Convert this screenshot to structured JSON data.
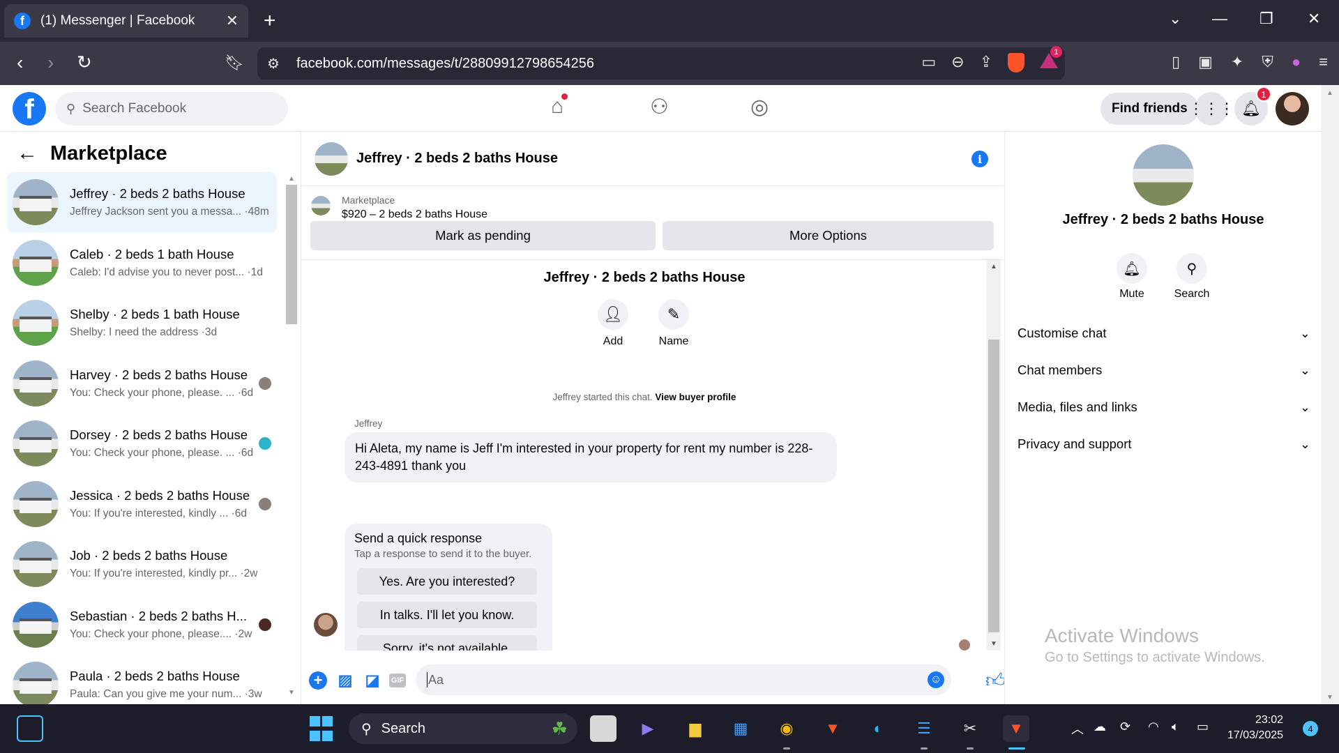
{
  "browser": {
    "tab_title": "(1) Messenger | Facebook",
    "url": "facebook.com/messages/t/28809912798654256",
    "rewards_badge": "1",
    "accent_color": "#fb542b"
  },
  "header": {
    "search_placeholder": "Search Facebook",
    "find_friends_label": "Find friends",
    "notification_count": "1",
    "brand_color": "#1877f2"
  },
  "sidebar": {
    "title": "Marketplace",
    "conversations": [
      {
        "name": "Jeffrey · 2 beds 2 baths House",
        "preview": "Jeffrey Jackson sent you a messa... ·48m",
        "active": true
      },
      {
        "name": "Caleb · 2 beds 1 bath House",
        "preview": "Caleb: I'd advise you to never post... ·1d"
      },
      {
        "name": "Shelby · 2 beds 1 bath House",
        "preview": "Shelby: I need the address ·3d"
      },
      {
        "name": "Harvey · 2 beds 2 baths House",
        "preview": "You: Check your phone, please. ... ·6d"
      },
      {
        "name": "Dorsey · 2 beds 2 baths House",
        "preview": "You: Check your phone, please. ... ·6d"
      },
      {
        "name": "Jessica · 2 beds 2 baths House",
        "preview": "You: If you're interested, kindly ... ·6d"
      },
      {
        "name": "Job · 2 beds 2 baths House",
        "preview": "You: If you're interested, kindly pr... ·2w"
      },
      {
        "name": "Sebastian · 2 beds 2 baths H...",
        "preview": "You: Check your phone, please.... ·2w"
      },
      {
        "name": "Paula · 2 beds 2 baths House",
        "preview": "Paula: Can you give me your num... ·3w"
      }
    ]
  },
  "chat": {
    "header_title": "Jeffrey · 2 beds 2 baths House",
    "marketplace_label": "Marketplace",
    "listing": "$920 – 2 beds 2 baths House",
    "mark_pending_label": "Mark as pending",
    "more_options_label": "More Options",
    "conversation_title": "Jeffrey · 2 beds 2 baths House",
    "add_label": "Add",
    "name_label": "Name",
    "started_text": "Jeffrey started this chat.",
    "view_profile_label": "View buyer profile",
    "sender_name": "Jeffrey",
    "message": "Hi Aleta, my name is Jeff I'm interested in your property for rent my number is 228-243-4891 thank you",
    "quick_title": "Send a quick response",
    "quick_subtitle": "Tap a response to send it to the buyer.",
    "quick_responses": [
      "Yes. Are you interested?",
      "In talks. I'll let you know.",
      "Sorry, it's not available."
    ],
    "composer_placeholder": "Aa",
    "gif_label": "GIF"
  },
  "details": {
    "name": "Jeffrey · 2 beds 2 baths House",
    "mute_label": "Mute",
    "search_label": "Search",
    "sections": [
      "Customise chat",
      "Chat members",
      "Media, files and links",
      "Privacy and support"
    ],
    "watermark_title": "Activate Windows",
    "watermark_sub": "Go to Settings to activate Windows."
  },
  "taskbar": {
    "search_label": "Search",
    "time": "23:02",
    "date": "17/03/2025",
    "notification_count": "4"
  }
}
